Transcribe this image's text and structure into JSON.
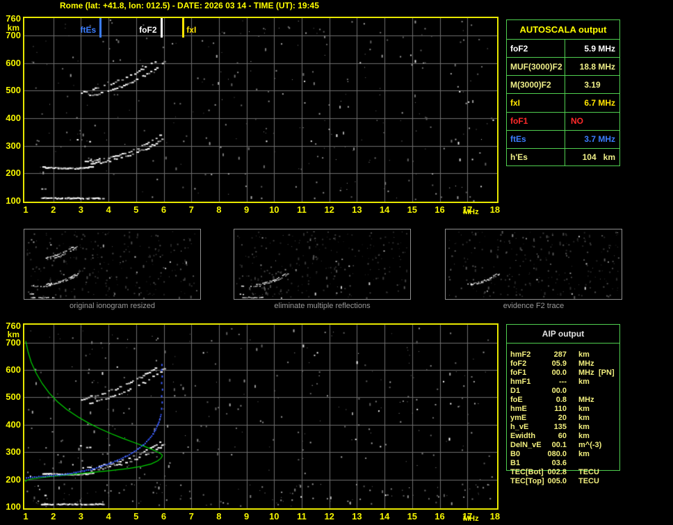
{
  "title": "Rome (lat: +41.8, lon: 012.5) - DATE: 2026 03 14 - TIME (UT): 19:45",
  "colors": {
    "axis": "#f5f500",
    "plot_border": "#e8e800",
    "grid": "#6f6f6f",
    "table_border": "#50d050",
    "profile_green": "#00d800",
    "restored_blue": "#2e52ff",
    "marker_ftEs": "#3b7dff",
    "marker_foF2": "#ffffff",
    "marker_fxI": "#ffe400",
    "caption_gray": "#9a9a9a"
  },
  "autoscala_table": {
    "title": "AUTOSCALA output",
    "rows": [
      {
        "label": "foF2",
        "value": "5.9 MHz",
        "color": "#ffffff",
        "align": "right"
      },
      {
        "label": "MUF(3000)F2",
        "value": "18.8 MHz",
        "color": "#eeee88",
        "align": "right"
      },
      {
        "label": "M(3000)F2",
        "value": "3.19",
        "color": "#eeee88",
        "align": "center"
      },
      {
        "label": "fxI",
        "value": "6.7 MHz",
        "color": "#ffe400",
        "align": "right"
      },
      {
        "label": "foF1",
        "value": "NO",
        "color": "#ff2a2a",
        "align": "left"
      },
      {
        "label": "ftEs",
        "value": "3.7 MHz",
        "color": "#3b7dff",
        "align": "right"
      },
      {
        "label": "h'Es",
        "value": "104   km",
        "color": "#eeee88",
        "align": "right"
      }
    ]
  },
  "aip_table": {
    "title": "AIP output",
    "rows": [
      {
        "label": "hmF2",
        "value": "287",
        "unit": "km",
        "extra": ""
      },
      {
        "label": "foF2",
        "value": "05.9",
        "unit": "MHz",
        "extra": ""
      },
      {
        "label": "foF1",
        "value": "00.0",
        "unit": "MHz",
        "extra": "[PN]"
      },
      {
        "label": "hmF1",
        "value": "---",
        "unit": "km",
        "extra": ""
      },
      {
        "label": "D1",
        "value": "00.0",
        "unit": "",
        "extra": ""
      },
      {
        "label": "foE",
        "value": "0.8",
        "unit": "MHz",
        "extra": ""
      },
      {
        "label": "hmE",
        "value": "110",
        "unit": "km",
        "extra": ""
      },
      {
        "label": "ymE",
        "value": "20",
        "unit": "km",
        "extra": ""
      },
      {
        "label": "h_vE",
        "value": "135",
        "unit": "km",
        "extra": ""
      },
      {
        "label": "Ewidth",
        "value": "60",
        "unit": "km",
        "extra": ""
      },
      {
        "label": "DelN_vE",
        "value": "00.1",
        "unit": "m^(-3)",
        "extra": ""
      },
      {
        "label": "B0",
        "value": "080.0",
        "unit": "km",
        "extra": ""
      },
      {
        "label": "B1",
        "value": "03.6",
        "unit": "",
        "extra": ""
      },
      {
        "label": "TEC[Bot]",
        "value": "002.8",
        "unit": "TECU",
        "extra": ""
      },
      {
        "label": "TEC[Top]",
        "value": "005.0",
        "unit": "TECU",
        "extra": ""
      }
    ]
  },
  "panels": [
    {
      "caption": "original ionogram resized",
      "show": [
        "Es trace",
        "Es dashes",
        "F flat",
        "F2 o-trace",
        "F2 x-trace",
        "F2 2nd hop o",
        "F2 2nd hop x"
      ]
    },
    {
      "caption": "eliminate multiple reflections",
      "show": [
        "Es trace",
        "Es dashes",
        "F flat",
        "F2 o-trace",
        "F2 x-trace"
      ]
    },
    {
      "caption": "evidence F2 trace",
      "show": [
        "F2 o-trace",
        "F2 x-trace"
      ]
    }
  ],
  "chart_data": [
    {
      "id": "top_ionogram",
      "type": "scatter",
      "title": "",
      "xlabel": "MHz",
      "ylabel": "km",
      "xlim": [
        1,
        18
      ],
      "ylim": [
        100,
        760
      ],
      "grid": true,
      "x_ticks": [
        1,
        2,
        3,
        4,
        5,
        6,
        7,
        8,
        9,
        10,
        11,
        12,
        13,
        14,
        15,
        16,
        17,
        18
      ],
      "y_ticks": [
        760,
        700,
        600,
        500,
        400,
        300,
        200,
        100
      ],
      "markers": [
        {
          "name": "ftEs",
          "f": 3.7,
          "color": "#3b7dff",
          "side": "left"
        },
        {
          "name": "foF2",
          "f": 5.9,
          "color": "#ffffff",
          "side": "left"
        },
        {
          "name": "fxI",
          "f": 6.7,
          "color": "#ffe400",
          "side": "right"
        }
      ],
      "series": [
        {
          "name": "Es trace",
          "style": "dense",
          "points": [
            [
              1.55,
              112
            ],
            [
              3.78,
              112
            ]
          ]
        },
        {
          "name": "Es dashes",
          "style": "sparse",
          "points": [
            [
              1.45,
              145
            ],
            [
              1.85,
              143
            ]
          ]
        },
        {
          "name": "F flat",
          "style": "dense",
          "points": [
            [
              1.6,
              224
            ],
            [
              2.2,
              221
            ],
            [
              2.8,
              220
            ],
            [
              3.2,
              223
            ],
            [
              3.45,
              227
            ]
          ]
        },
        {
          "name": "F1 cusp",
          "style": "sparse",
          "points": [
            [
              2.85,
              325
            ],
            [
              3.35,
              318
            ]
          ]
        },
        {
          "name": "F2 o-trace",
          "style": "dash",
          "points": [
            [
              3.05,
              243
            ],
            [
              3.4,
              248
            ],
            [
              3.8,
              255
            ],
            [
              4.2,
              264
            ],
            [
              4.6,
              276
            ],
            [
              5.0,
              291
            ],
            [
              5.3,
              306
            ],
            [
              5.55,
              320
            ],
            [
              5.75,
              334
            ],
            [
              5.88,
              345
            ]
          ]
        },
        {
          "name": "F2 x-trace",
          "style": "dash",
          "points": [
            [
              3.35,
              236
            ],
            [
              3.75,
              243
            ],
            [
              4.15,
              251
            ],
            [
              4.55,
              262
            ],
            [
              4.95,
              276
            ],
            [
              5.35,
              292
            ],
            [
              5.7,
              311
            ],
            [
              5.95,
              328
            ],
            [
              6.1,
              342
            ]
          ]
        },
        {
          "name": "F2 2nd hop o",
          "style": "dash",
          "points": [
            [
              3.0,
              496
            ],
            [
              3.4,
              506
            ],
            [
              3.8,
              518
            ],
            [
              4.2,
              532
            ],
            [
              4.6,
              549
            ],
            [
              5.0,
              568
            ],
            [
              5.3,
              585
            ],
            [
              5.55,
              600
            ],
            [
              5.72,
              612
            ]
          ]
        },
        {
          "name": "F2 2nd hop x",
          "style": "dash",
          "points": [
            [
              3.3,
              482
            ],
            [
              3.7,
              492
            ],
            [
              4.1,
              504
            ],
            [
              4.5,
              519
            ],
            [
              4.9,
              537
            ],
            [
              5.3,
              558
            ],
            [
              5.65,
              580
            ],
            [
              5.9,
              598
            ],
            [
              6.02,
              610
            ]
          ]
        }
      ],
      "noise_seed": 1234
    },
    {
      "id": "bottom_ionogram",
      "type": "scatter",
      "title": "",
      "xlabel": "MHz",
      "ylabel": "km",
      "xlim": [
        1,
        18
      ],
      "ylim": [
        100,
        760
      ],
      "grid": true,
      "x_ticks": [
        1,
        2,
        3,
        4,
        5,
        6,
        7,
        8,
        9,
        10,
        11,
        12,
        13,
        14,
        15,
        16,
        17,
        18
      ],
      "y_ticks": [
        760,
        700,
        600,
        500,
        400,
        300,
        200,
        100
      ],
      "series_ref": 0,
      "profile": {
        "name": "Ne profile",
        "color": "#00d800",
        "points": [
          [
            1.0,
            706
          ],
          [
            1.08,
            668
          ],
          [
            1.2,
            628
          ],
          [
            1.38,
            588
          ],
          [
            1.6,
            550
          ],
          [
            1.85,
            516
          ],
          [
            2.15,
            484
          ],
          [
            2.5,
            455
          ],
          [
            2.9,
            428
          ],
          [
            3.3,
            405
          ],
          [
            3.7,
            385
          ],
          [
            4.1,
            367
          ],
          [
            4.5,
            351
          ],
          [
            4.9,
            336
          ],
          [
            5.25,
            323
          ],
          [
            5.55,
            311
          ],
          [
            5.75,
            302
          ],
          [
            5.88,
            295
          ],
          [
            5.94,
            290
          ],
          [
            5.95,
            287
          ],
          [
            5.9,
            278
          ],
          [
            5.78,
            268
          ],
          [
            5.55,
            257
          ],
          [
            5.2,
            248
          ],
          [
            4.7,
            240
          ],
          [
            4.1,
            233
          ],
          [
            3.4,
            226
          ],
          [
            2.7,
            219
          ],
          [
            2.0,
            212
          ],
          [
            1.5,
            206
          ],
          [
            1.15,
            201
          ],
          [
            0.98,
            196
          ],
          [
            0.93,
            191
          ]
        ]
      },
      "restored": {
        "name": "restored F2 trace",
        "color": "#2e52ff",
        "points": [
          [
            1.0,
            209
          ],
          [
            1.3,
            211
          ],
          [
            1.6,
            213
          ],
          [
            1.9,
            216
          ],
          [
            2.2,
            219
          ],
          [
            2.5,
            223
          ],
          [
            2.8,
            228
          ],
          [
            3.1,
            234
          ],
          [
            3.4,
            241
          ],
          [
            3.7,
            250
          ],
          [
            4.0,
            260
          ],
          [
            4.3,
            272
          ],
          [
            4.6,
            286
          ],
          [
            4.85,
            300
          ],
          [
            5.05,
            314
          ],
          [
            5.25,
            330
          ],
          [
            5.45,
            350
          ],
          [
            5.6,
            370
          ],
          [
            5.7,
            388
          ],
          [
            5.78,
            406
          ],
          [
            5.84,
            424
          ],
          [
            5.88,
            440
          ]
        ]
      },
      "restored_sparse": [
        [
          5.9,
          462
        ],
        [
          5.92,
          485
        ],
        [
          5.9,
          508
        ],
        [
          5.93,
          532
        ],
        [
          5.9,
          556
        ],
        [
          5.92,
          580
        ],
        [
          5.9,
          604
        ],
        [
          5.91,
          622
        ]
      ],
      "noise_seed": 977
    }
  ]
}
